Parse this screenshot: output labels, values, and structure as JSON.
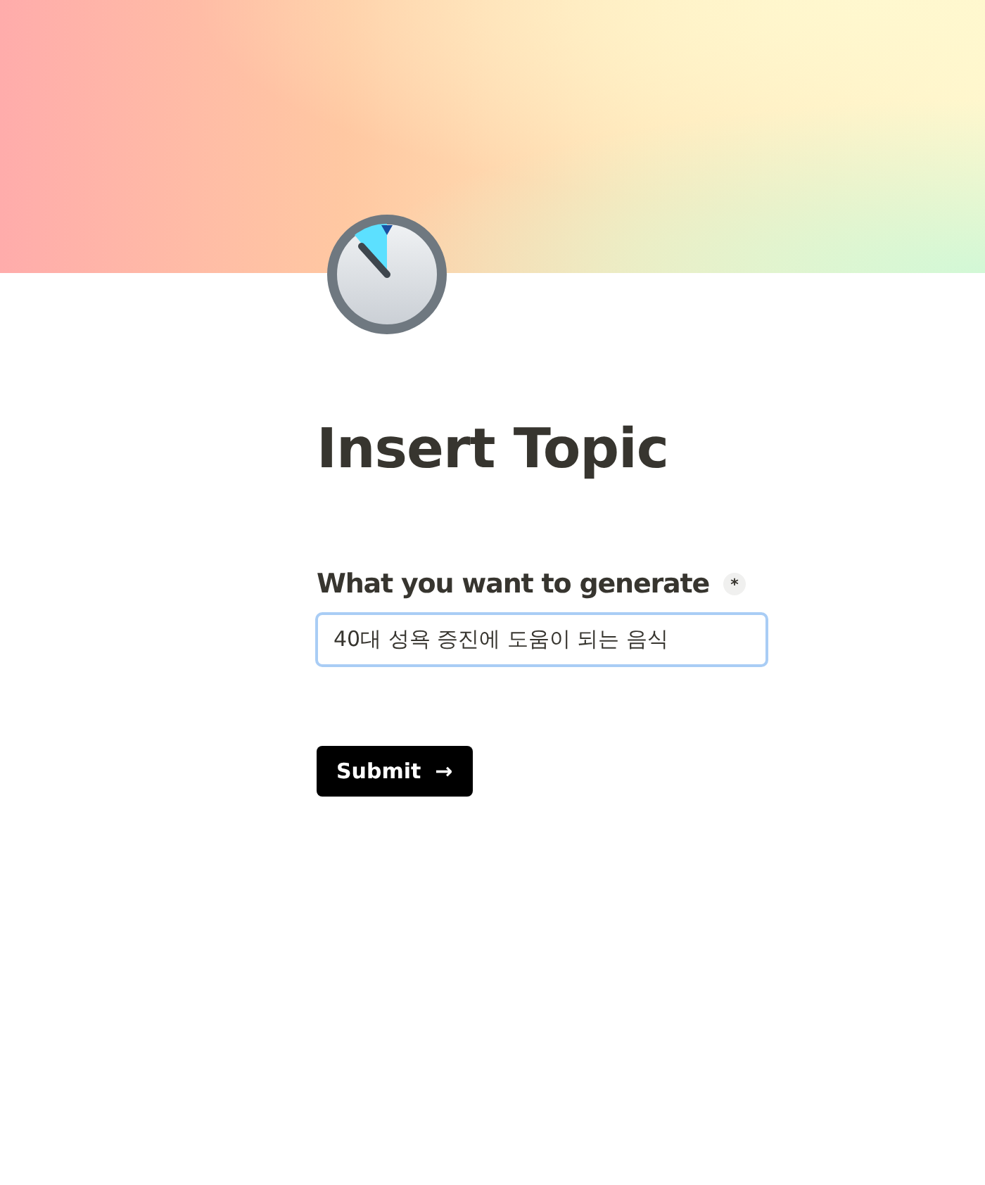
{
  "title": "Insert Topic",
  "field": {
    "label": "What you want to generate",
    "required_mark": "*",
    "value": "40대 성욕 증진에 도움이 되는 음식",
    "focused": true
  },
  "submit": {
    "label": "Submit",
    "icon": "→"
  }
}
